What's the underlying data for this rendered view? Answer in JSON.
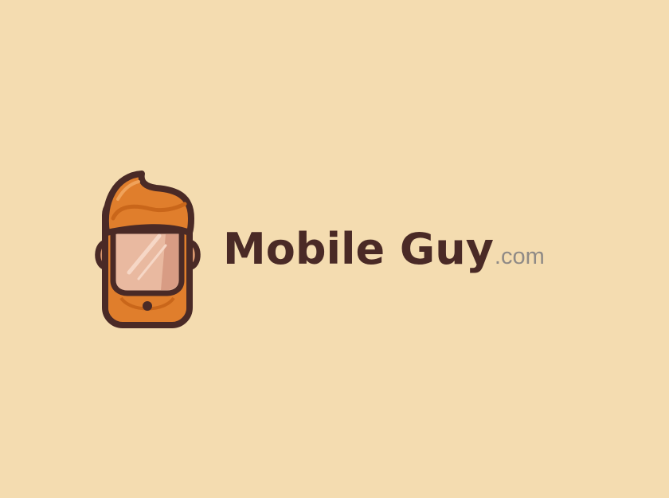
{
  "logo": {
    "name": "Mobile Guy",
    "tld": ".com",
    "icon": "mobile-guy-phone-face-icon"
  },
  "colors": {
    "background": "#f4dcb0",
    "outline": "#4a2a26",
    "hair": "#e07e2c",
    "hair_shade": "#c9661a",
    "screen": "#e9b9a0",
    "screen_shade": "#d89c84",
    "beard": "#e07e2c",
    "ear": "#d9976f",
    "tld_text": "#8f8a86"
  }
}
